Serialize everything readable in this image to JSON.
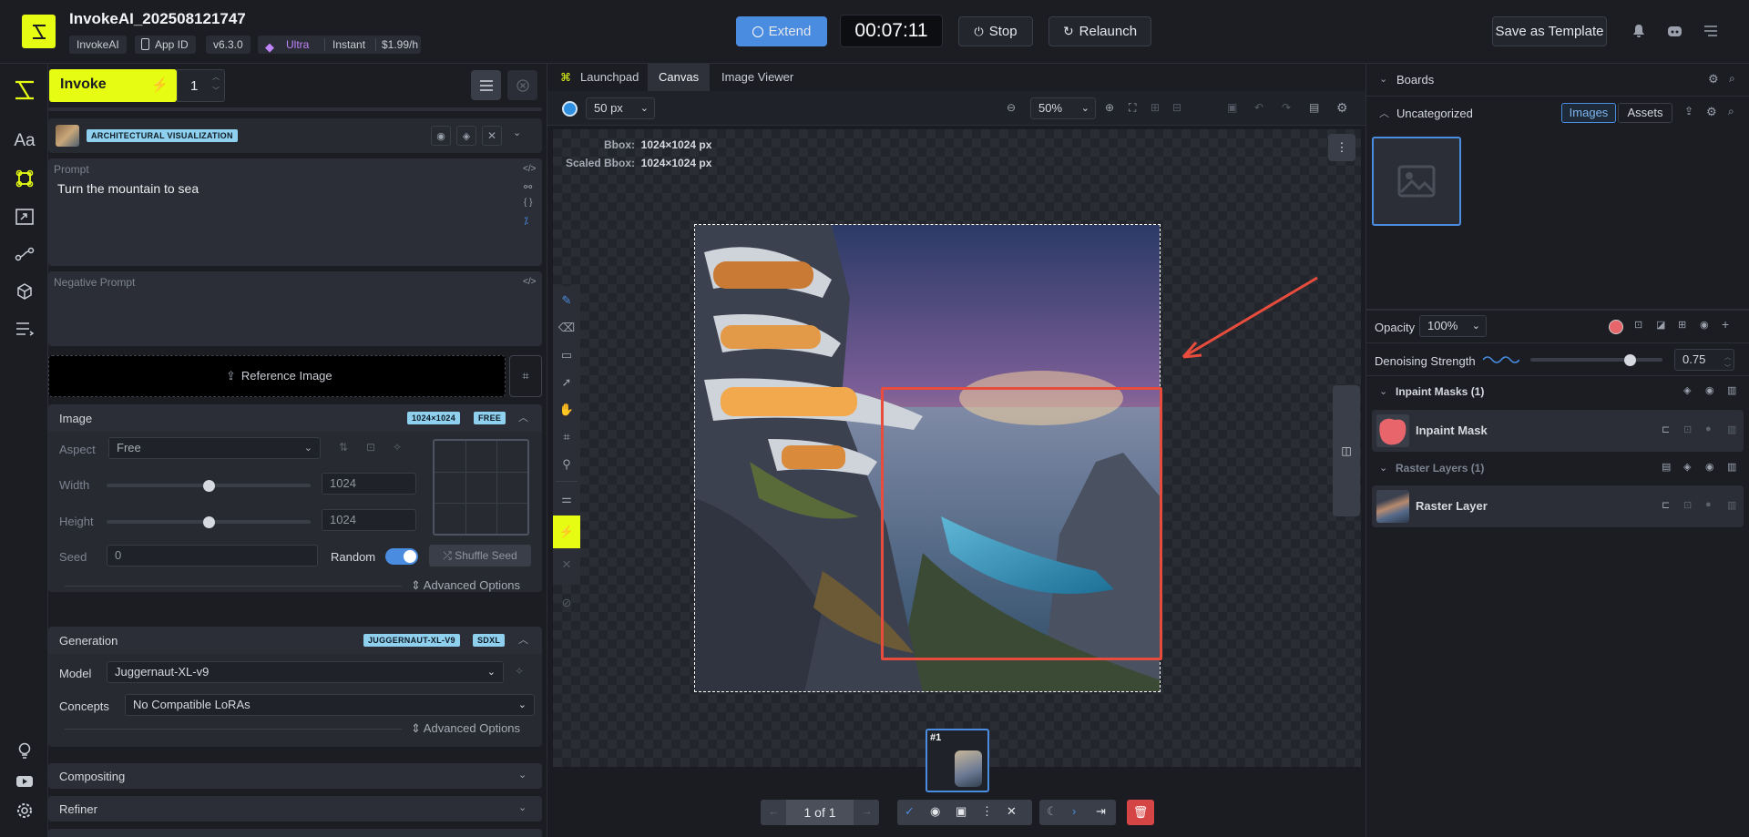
{
  "app": {
    "title": "InvokeAI_202508121747",
    "chips": [
      "InvokeAI",
      "App ID",
      "v6.3.0"
    ],
    "plan": {
      "tier": "Ultra",
      "mode": "Instant",
      "price": "$1.99/h"
    },
    "timer": "00:07:11",
    "extend_label": "Extend",
    "stop_label": "Stop",
    "relaunch_label": "Relaunch",
    "save_template_label": "Save as Template"
  },
  "invoke": {
    "label": "Invoke",
    "count": "1"
  },
  "style_preset": {
    "badge": "ARCHITECTURAL VISUALIZATION"
  },
  "prompt": {
    "label": "Prompt",
    "value": "Turn the mountain to sea"
  },
  "negative_prompt": {
    "label": "Negative Prompt",
    "value": ""
  },
  "reference_image": {
    "label": "Reference Image"
  },
  "image_section": {
    "title": "Image",
    "badge_size": "1024×1024",
    "badge_free": "FREE",
    "aspect_label": "Aspect",
    "aspect_value": "Free",
    "width_label": "Width",
    "width_value": "1024",
    "width_fraction": 0.5,
    "height_label": "Height",
    "height_value": "1024",
    "height_fraction": 0.5,
    "seed_label": "Seed",
    "seed_value": "0",
    "random_label": "Random",
    "shuffle_label": "Shuffle Seed",
    "advanced_label": "Advanced Options"
  },
  "generation": {
    "title": "Generation",
    "badge_model": "JUGGERNAUT-XL-V9",
    "badge_arch": "SDXL",
    "model_label": "Model",
    "model_value": "Juggernaut-XL-v9",
    "concepts_label": "Concepts",
    "concepts_value": "No Compatible LoRAs",
    "advanced_label": "Advanced Options"
  },
  "compositing": {
    "title": "Compositing"
  },
  "refiner": {
    "title": "Refiner"
  },
  "center_tabs": [
    "Launchpad",
    "Canvas",
    "Image Viewer"
  ],
  "canvas": {
    "brush_size": "50 px",
    "zoom": "50%",
    "bbox_label": "Bbox:",
    "bbox_value": "1024×1024 px",
    "scaled_bbox_label": "Scaled Bbox:",
    "scaled_bbox_value": "1024×1024 px",
    "staging_index": "#1",
    "staging_count": "1 of 1"
  },
  "right_panel": {
    "boards_label": "Boards",
    "board_name": "Uncategorized",
    "tab_images": "Images",
    "tab_assets": "Assets",
    "opacity_label": "Opacity",
    "opacity_value": "100%",
    "denoise_label": "Denoising Strength",
    "denoise_value": "0.75",
    "inpaint_group": "Inpaint Masks (1)",
    "inpaint_layer": "Inpaint Mask",
    "raster_group": "Raster Layers (1)",
    "raster_layer": "Raster Layer"
  },
  "colors": {
    "accent": "#e6fd13",
    "extend": "#4a8ce0",
    "badge": "#8fd0ee",
    "mask_red": "#e74c3c",
    "delete": "#d64545"
  }
}
